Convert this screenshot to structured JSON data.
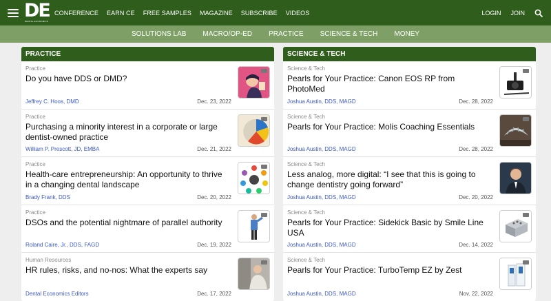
{
  "logo": {
    "big": "DE",
    "small": "DENTAL ECONOMICS"
  },
  "topnav": [
    "CONFERENCE",
    "EARN CE",
    "FREE SAMPLES",
    "MAGAZINE",
    "SUBSCRIBE",
    "VIDEOS"
  ],
  "topright": {
    "login": "LOGIN",
    "join": "JOIN"
  },
  "subnav": [
    "SOLUTIONS LAB",
    "MACRO/OP-ED",
    "PRACTICE",
    "SCIENCE & TECH",
    "MONEY"
  ],
  "practice": {
    "header": "PRACTICE",
    "articles": [
      {
        "category": "Practice",
        "title": "Do you have DDS or DMD?",
        "author": "Jeffrey C. Hoos, DMD",
        "date": "Dec. 23, 2022"
      },
      {
        "category": "Practice",
        "title": "Purchasing a minority interest in a corporate or large dentist-owned practice",
        "author": "William P. Prescott, JD, EMBA",
        "date": "Dec. 21, 2022"
      },
      {
        "category": "Practice",
        "title": "Health-care entrepreneurship: An opportunity to thrive in a changing dental landscape",
        "author": "Brady Frank, DDS",
        "date": "Dec. 20, 2022"
      },
      {
        "category": "Practice",
        "title": "DSOs and the potential nightmare of parallel authority",
        "author": "Roland Caire, Jr., DDS, FAGD",
        "date": "Dec. 19, 2022"
      },
      {
        "category": "Human Resources",
        "title": "HR rules, risks, and no-nos: What the experts say",
        "author": "Dental Economics Editors",
        "date": "Dec. 17, 2022"
      }
    ]
  },
  "science": {
    "header": "SCIENCE & TECH",
    "articles": [
      {
        "category": "Science & Tech",
        "title": "Pearls for Your Practice: Canon EOS RP from PhotoMed",
        "author": "Joshua Austin, DDS, MAGD",
        "date": "Dec. 28, 2022"
      },
      {
        "category": "Science & Tech",
        "title": "Pearls for Your Practice: Molis Coaching Essentials",
        "author": "Joshua Austin, DDS, MAGD",
        "date": "Dec. 28, 2022"
      },
      {
        "category": "Science & Tech",
        "title": "Less analog, more digital: “I see that this is going to change dentistry going forward”",
        "author": "Joshua Austin, DDS, MAGD",
        "date": "Dec. 20, 2022"
      },
      {
        "category": "Science & Tech",
        "title": "Pearls for Your Practice: Sidekick Basic by Smile Line USA",
        "author": "Joshua Austin, DDS, MAGD",
        "date": "Dec. 14, 2022"
      },
      {
        "category": "Science & Tech",
        "title": "Pearls for Your Practice: TurboTemp EZ by Zest",
        "author": "Joshua Austin, DDS, MAGD",
        "date": "Nov. 22, 2022"
      }
    ]
  },
  "colors": {
    "brand_green": "#2f5d1c",
    "subnav_green": "#7ea067",
    "author_blue": "#3b58c8"
  },
  "icons": [
    "hamburger-icon",
    "search-icon"
  ]
}
